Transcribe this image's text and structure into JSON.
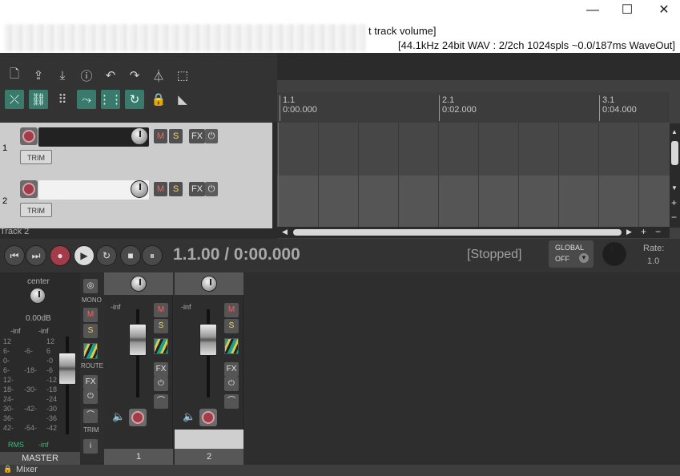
{
  "titlebar": {
    "title": "t track volume]",
    "status": "[44.1kHz 24bit WAV : 2/2ch 1024spls ~0.0/187ms WaveOut]",
    "minimize": "—",
    "maximize": "☐",
    "close": "✕"
  },
  "ruler": {
    "markers": [
      {
        "bar": "1.1",
        "time": "0:00.000"
      },
      {
        "bar": "2.1",
        "time": "0:02.000"
      },
      {
        "bar": "3.1",
        "time": "0:04.000"
      }
    ]
  },
  "tracks": [
    {
      "number": "1",
      "trim": "TRIM",
      "m": "M",
      "s": "S",
      "fx": "FX"
    },
    {
      "number": "2",
      "trim": "TRIM",
      "m": "M",
      "s": "S",
      "fx": "FX"
    }
  ],
  "selected_track_name": "Track 2",
  "transport": {
    "timecode": "1.1.00 / 0:00.000",
    "state": "[Stopped]",
    "global_label": "GLOBAL",
    "global_value": "OFF",
    "rate_label": "Rate:",
    "rate_value": "1.0"
  },
  "master": {
    "pan": "center",
    "level": "0.00dB",
    "peak_left": "-inf",
    "peak_right": "-inf",
    "scale_left": [
      "12",
      "6-",
      "0-",
      "6-",
      "12-",
      "18-",
      "24-",
      "30-",
      "36-",
      "42-"
    ],
    "scale_mid": [
      "-6-",
      "-18-",
      "-30-",
      "-42-",
      "-54-"
    ],
    "scale_right": [
      "12",
      "6",
      "-0",
      "-6",
      "-12",
      "-18",
      "-24",
      "-30",
      "-36",
      "-42"
    ],
    "mono": "MONO",
    "m": "M",
    "s": "S",
    "route": "ROUTE",
    "fx": "FX",
    "trim": "TRIM",
    "info": "i",
    "rms_label": "RMS",
    "rms_value": "-inf",
    "name": "MASTER"
  },
  "strips": [
    {
      "peak": "-inf",
      "m": "M",
      "s": "S",
      "fx": "FX",
      "label": "1"
    },
    {
      "peak": "-inf",
      "m": "M",
      "s": "S",
      "fx": "FX",
      "label": "2"
    }
  ],
  "bottom": {
    "mixer_tab": "Mixer"
  },
  "colors": {
    "toggle_accent": "#3a7a6c",
    "record_red": "#a43b48",
    "mute_red": "#ff5c5c",
    "solo_yellow": "#f4d36b"
  }
}
